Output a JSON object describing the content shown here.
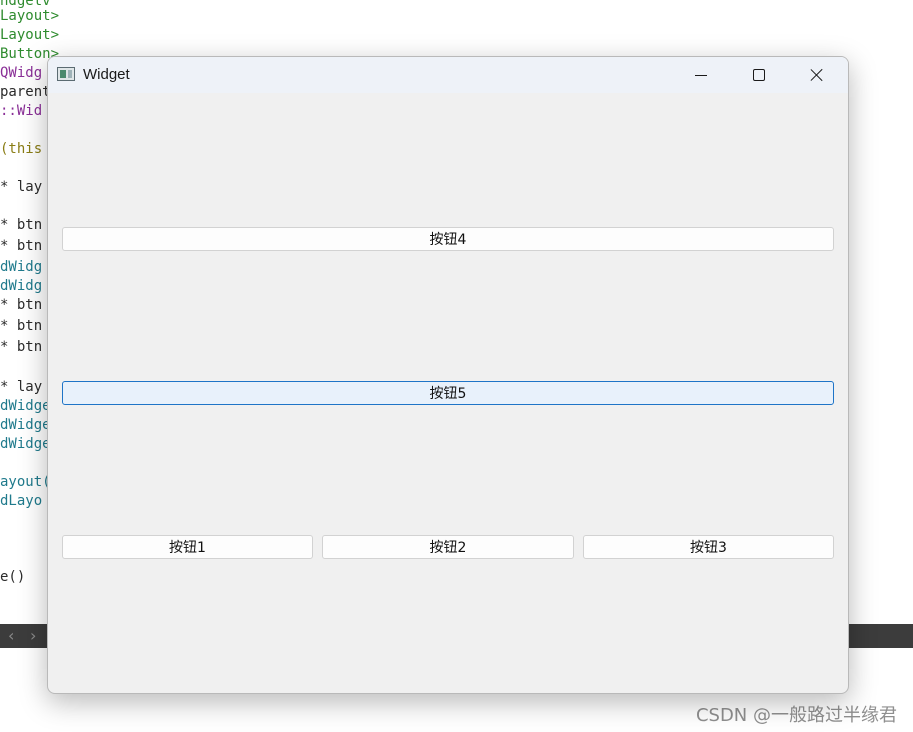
{
  "background_editor": {
    "lines": [
      {
        "text": "ndgetv",
        "color": "green"
      },
      {
        "text": "Layout>",
        "color": "green"
      },
      {
        "text": "Layout>",
        "color": "green"
      },
      {
        "text": "Button>",
        "color": "green"
      },
      {
        "text": "QWidg",
        "color": "purple"
      },
      {
        "text": "parent",
        "color": "dark"
      },
      {
        "text": "::Wid",
        "color": "purple"
      },
      {
        "text": "(this",
        "color": "olive"
      },
      {
        "text": "* lay",
        "color": "dark"
      },
      {
        "text": "* btn",
        "color": "dark"
      },
      {
        "text": "* btn",
        "color": "dark"
      },
      {
        "text": "dWidg",
        "color": "teal"
      },
      {
        "text": "dWidg",
        "color": "teal"
      },
      {
        "text": "* btn",
        "color": "dark"
      },
      {
        "text": "* btn",
        "color": "dark"
      },
      {
        "text": "* btn",
        "color": "dark"
      },
      {
        "text": "* lay",
        "color": "dark"
      },
      {
        "text": "dWidge",
        "color": "teal"
      },
      {
        "text": "dWidge",
        "color": "teal"
      },
      {
        "text": "dWidge",
        "color": "teal"
      },
      {
        "text": "ayout(",
        "color": "teal"
      },
      {
        "text": "dLayo",
        "color": "teal"
      },
      {
        "text": "e()",
        "color": "dark"
      }
    ],
    "nav_left": "‹",
    "nav_right": "›"
  },
  "watermark": "CSDN @一般路过半缘君",
  "window": {
    "title": "Widget",
    "icon": "qt-app-icon",
    "caption_buttons": [
      "minimize",
      "maximize",
      "close"
    ]
  },
  "buttons": {
    "btn4": "按钮4",
    "btn5": "按钮5",
    "btn1": "按钮1",
    "btn2": "按钮2",
    "btn3": "按钮3"
  },
  "colors": {
    "window_bg": "#f0f0f0",
    "titlebar_bg": "#eef2f8",
    "focus_border": "#1e74c7",
    "code_green": "#2e8b2e",
    "code_purple": "#8a2f97",
    "code_teal": "#1f7a8c"
  }
}
